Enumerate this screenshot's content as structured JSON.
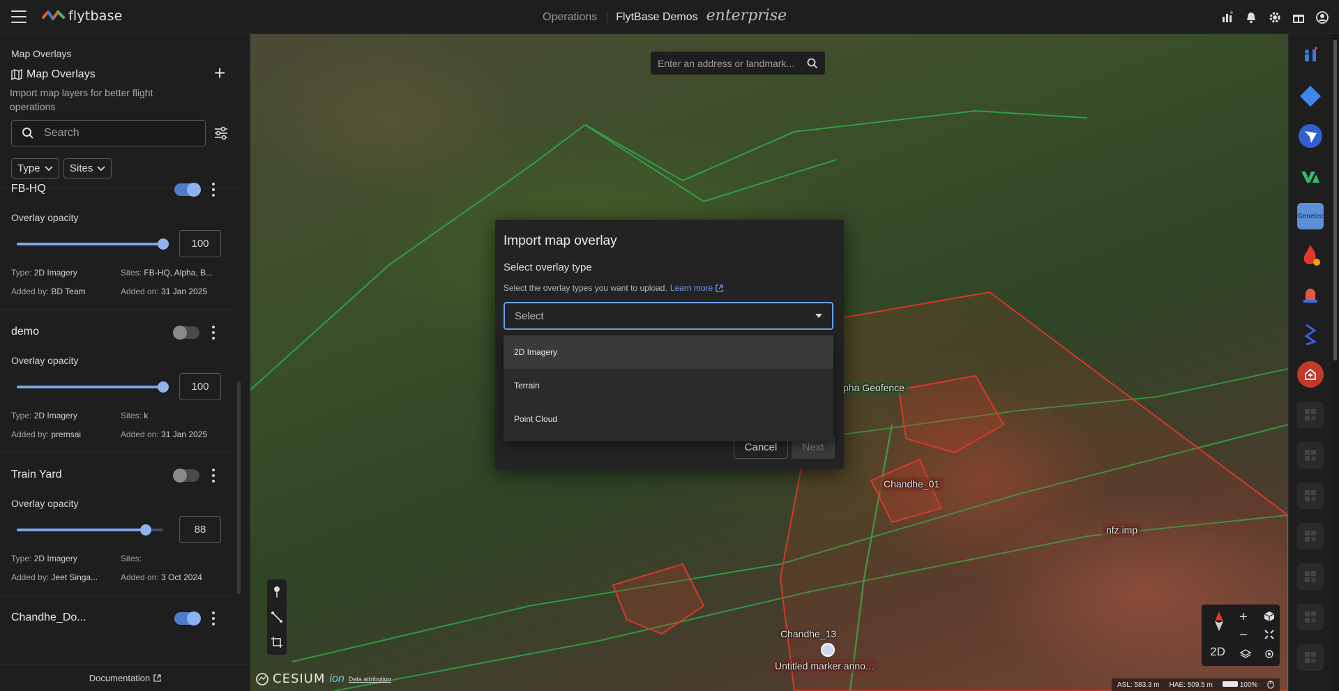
{
  "header": {
    "logo_text": "flytbase",
    "nav_operations": "Operations",
    "org_name": "FlytBase Demos",
    "edition": "enterprise",
    "icons": [
      "analytics-icon",
      "bell-icon",
      "gear-icon",
      "gift-icon",
      "user-account-icon"
    ]
  },
  "sidebar": {
    "section_label": "Map Overlays",
    "title": "Map Overlays",
    "description": "Import map layers for better flight operations",
    "search_placeholder": "Search",
    "filters": {
      "type_label": "Type",
      "sites_label": "Sites"
    },
    "overlays": [
      {
        "name": "FB-HQ",
        "enabled": true,
        "opacity_label": "Overlay opacity",
        "opacity": 100,
        "type_key": "Type:",
        "type_value": "2D Imagery",
        "sites_key": "Sites:",
        "sites_value": "FB-HQ, Alpha, B...",
        "added_by_key": "Added by:",
        "added_by_value": "BD Team",
        "added_on_key": "Added on:",
        "added_on_value": "31 Jan 2025"
      },
      {
        "name": "demo",
        "enabled": false,
        "opacity_label": "Overlay opacity",
        "opacity": 100,
        "type_key": "Type:",
        "type_value": "2D Imagery",
        "sites_key": "Sites:",
        "sites_value": "k",
        "added_by_key": "Added by:",
        "added_by_value": "premsai",
        "added_on_key": "Added on:",
        "added_on_value": "31 Jan 2025"
      },
      {
        "name": "Train Yard",
        "enabled": false,
        "opacity_label": "Overlay opacity",
        "opacity": 88,
        "type_key": "Type:",
        "type_value": "2D Imagery",
        "sites_key": "Sites:",
        "sites_value": "",
        "added_by_key": "Added by:",
        "added_by_value": "Jeet Singa...",
        "added_on_key": "Added on:",
        "added_on_value": "3 Oct 2024"
      },
      {
        "name": "Chandhe_Do...",
        "enabled": true
      }
    ],
    "footer_link": "Documentation"
  },
  "map": {
    "search_placeholder": "Enter an address or landmark...",
    "labels": {
      "alpha_geofence": "pha Geofence",
      "chandhe_01": "Chandhe_01",
      "nfz_imp": "nfz imp",
      "chandhe_13": "Chandhe_13",
      "untitled_marker": "Untitled marker anno..."
    },
    "view_mode": "2D",
    "attribution_brand": "CESIUM",
    "attribution_ion": "ion",
    "attribution_link": "Data attribution",
    "status": {
      "asl": "ASL: 583.3 m",
      "hae": "HAE: 509.5 m",
      "battery": "100%"
    }
  },
  "dialog": {
    "title": "Import map overlay",
    "subtitle": "Select overlay type",
    "help_text": "Select the overlay types you want to upload.",
    "learn_more": "Learn more",
    "select_placeholder": "Select",
    "options": [
      "2D Imagery",
      "Terrain",
      "Point Cloud"
    ],
    "highlighted_option": "2D Imagery",
    "cancel_label": "Cancel",
    "next_label": "Next"
  },
  "colors": {
    "accent": "#6d9fee",
    "toggle_on": "#4f7cc8",
    "panel_bg": "#1e1e1e",
    "geofence_green": "#2ea84a",
    "nfz_red": "#d8382a"
  }
}
